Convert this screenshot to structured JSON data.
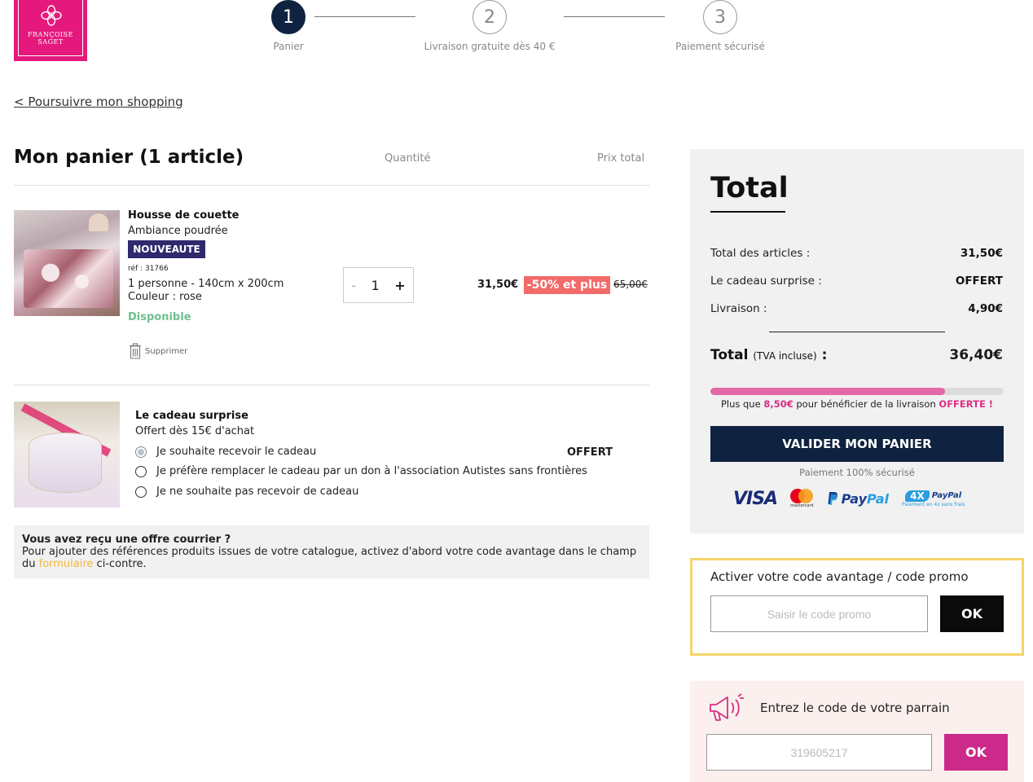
{
  "brand": {
    "logo_line1": "FRANÇOISE",
    "logo_line2": "SAGET",
    "color": "#e5197d"
  },
  "stepper": {
    "steps": [
      {
        "number": "1",
        "label": "Panier",
        "active": true
      },
      {
        "number": "2",
        "label": "Livraison gratuite dès 40 €",
        "active": false
      },
      {
        "number": "3",
        "label": "Paiement sécurisé",
        "active": false
      }
    ]
  },
  "nav": {
    "back_link": "< Poursuivre mon shopping"
  },
  "cart": {
    "title": "Mon panier (1 article)",
    "col_quantity": "Quantité",
    "col_total": "Prix total",
    "item": {
      "name": "Housse de couette",
      "subtitle": "Ambiance poudrée",
      "badge": "NOUVEAUTE",
      "ref": "réf : 31766",
      "size": "1 personne - 140cm x 200cm",
      "color": "Couleur : rose",
      "availability": "Disponible",
      "remove_label": "Supprimer",
      "qty_minus": "-",
      "quantity": "1",
      "qty_plus": "+",
      "price": "31,50€",
      "discount_tag": "-50% et plus",
      "old_price": "65,00€"
    },
    "gift": {
      "title": "Le cadeau surprise",
      "subtitle": "Offert dès 15€ d'achat",
      "options": [
        {
          "label": "Je souhaite recevoir le cadeau",
          "checked": true
        },
        {
          "label": "Je préfère remplacer le cadeau par un don à l'association Autistes sans frontières",
          "checked": false
        },
        {
          "label": "Je ne souhaite pas recevoir de cadeau",
          "checked": false
        }
      ],
      "offert_label": "OFFERT"
    },
    "mail_offer": {
      "title": "Vous avez reçu une offre courrier ?",
      "text_before": "Pour ajouter des références produits issues de votre catalogue, activez d'abord votre code avantage dans le champ du ",
      "link": "formulaire",
      "text_after": " ci-contre."
    }
  },
  "summary": {
    "title": "Total",
    "rows": [
      {
        "label": "Total des articles :",
        "value": "31,50€"
      },
      {
        "label": "Le cadeau surprise :",
        "value": "OFFERT"
      },
      {
        "label": "Livraison :",
        "value": "4,90€"
      }
    ],
    "grand_label": "Total",
    "grand_label_small": "(TVA incluse)",
    "grand_colon": " :",
    "grand_value": "36,40€",
    "progress_fraction": 0.8,
    "shipping_msg_before": "Plus que ",
    "shipping_msg_amount": "8,50€",
    "shipping_msg_middle": " pour bénéficier de la livraison ",
    "shipping_msg_end": "OFFERTE !",
    "validate_button": "VALIDER MON PANIER",
    "secure_text": "Paiement 100% sécurisé",
    "payment_logos": {
      "visa": "VISA",
      "mastercard": "mastercard",
      "paypal_pay": "Pay",
      "paypal_pal": "Pal",
      "paypal4x_badge": "4X",
      "paypal4x_pay": "PayPal",
      "paypal4x_sub": "Paiement en 4x sans frais"
    }
  },
  "promo": {
    "title": "Activer votre code avantage / code promo",
    "placeholder": "Saisir le code promo",
    "button": "OK"
  },
  "referral": {
    "title": "Entrez le code de votre parrain",
    "placeholder": "319605217",
    "button": "OK",
    "icon": "megaphone-icon"
  },
  "colors": {
    "navy": "#0f2240",
    "pink": "#cc2a8a",
    "discount": "#f26a6a",
    "available": "#6fc08f",
    "promo_border": "#f5d56a"
  }
}
